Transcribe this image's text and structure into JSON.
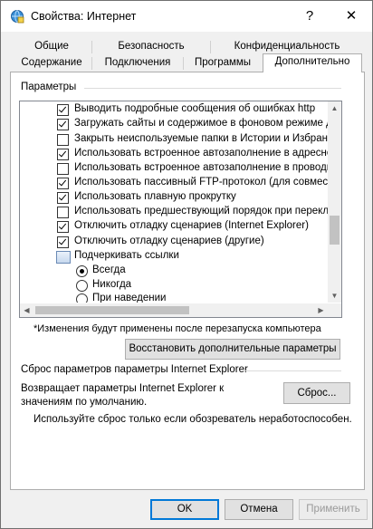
{
  "window": {
    "title": "Свойства: Интернет",
    "help_label": "?",
    "close_label": "✕"
  },
  "tabs_row1": [
    "Общие",
    "Безопасность",
    "Конфиденциальность"
  ],
  "tabs_row2": [
    "Содержание",
    "Подключения",
    "Программы",
    "Дополнительно"
  ],
  "active_tab": "Дополнительно",
  "settings": {
    "group_label": "Параметры",
    "items": [
      {
        "type": "checkbox",
        "checked": true,
        "label": "Выводить подробные сообщения об ошибках http"
      },
      {
        "type": "checkbox",
        "checked": true,
        "label": "Загружать сайты и содержимое в фоновом режиме для"
      },
      {
        "type": "checkbox",
        "checked": false,
        "label": "Закрыть неиспользуемые папки в Истории и Избранно"
      },
      {
        "type": "checkbox",
        "checked": true,
        "label": "Использовать встроенное автозаполнение в адресной"
      },
      {
        "type": "checkbox",
        "checked": false,
        "label": "Использовать встроенное автозаполнение в проводни"
      },
      {
        "type": "checkbox",
        "checked": true,
        "label": "Использовать пассивный FTP-протокол (для совмести"
      },
      {
        "type": "checkbox",
        "checked": true,
        "label": "Использовать плавную прокрутку"
      },
      {
        "type": "checkbox",
        "checked": false,
        "label": "Использовать предшествующий порядок при перекл"
      },
      {
        "type": "checkbox",
        "checked": true,
        "label": "Отключить отладку сценариев (Internet Explorer)"
      },
      {
        "type": "checkbox",
        "checked": true,
        "label": "Отключить отладку сценариев (другие)"
      },
      {
        "type": "header",
        "icon": "link-settings-icon",
        "label": "Подчеркивать ссылки"
      },
      {
        "type": "radio",
        "checked": true,
        "label": "Всегда"
      },
      {
        "type": "radio",
        "checked": false,
        "label": "Никогда"
      },
      {
        "type": "radio",
        "checked": false,
        "label": "При наведении"
      }
    ]
  },
  "restart_note": "*Изменения будут применены после перезапуска компьютера",
  "restore_button": "Восстановить дополнительные параметры",
  "reset": {
    "title": "Сброс параметров параметры Internet Explorer",
    "description": "Возвращает параметры Internet Explorer к значениям по умолчанию.",
    "button": "Сброс...",
    "note": "Используйте сброс только если обозреватель неработоспособен."
  },
  "footer": {
    "ok": "OK",
    "cancel": "Отмена",
    "apply": "Применить"
  }
}
